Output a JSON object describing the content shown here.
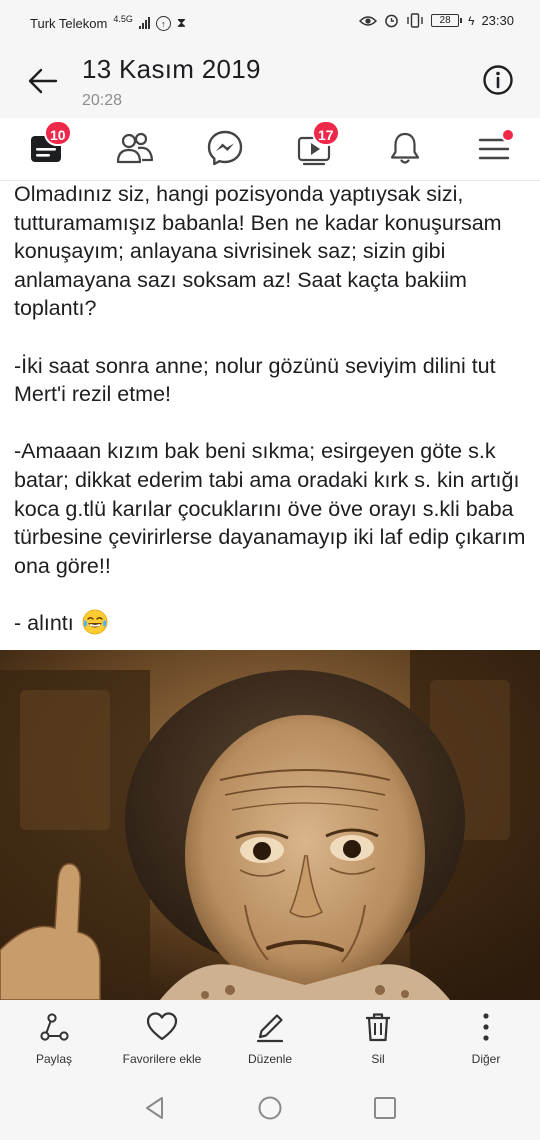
{
  "status_bar": {
    "carrier": "Turk Telekom",
    "network": "4.5G",
    "battery_level": "28",
    "time": "23:30",
    "icons": [
      "signal-icon",
      "data-saver-icon",
      "hourglass-icon",
      "eye-comfort-icon",
      "alarm-icon",
      "vibrate-icon",
      "battery-icon",
      "charging-icon"
    ]
  },
  "header": {
    "title": "13 Kasım 2019",
    "time": "20:28",
    "icons": [
      "back-arrow-icon",
      "info-icon"
    ]
  },
  "nav": {
    "items": [
      {
        "name": "home",
        "icon": "feed-icon",
        "badge": "10"
      },
      {
        "name": "friends",
        "icon": "friends-icon",
        "badge": ""
      },
      {
        "name": "messenger",
        "icon": "messenger-icon",
        "badge": ""
      },
      {
        "name": "watch",
        "icon": "video-icon",
        "badge": "17"
      },
      {
        "name": "notifications",
        "icon": "bell-icon",
        "badge": ""
      },
      {
        "name": "menu",
        "icon": "hamburger-icon",
        "badge": ""
      }
    ],
    "badge_color": "#f02849"
  },
  "post": {
    "paragraphs": [
      "Olmadınız siz, hangi pozisyonda yaptıysak sizi, tutturamamışız babanla! Ben ne kadar konuşursam konuşayım; anlayana sivrisinek saz; sizin gibi anlamayana sazı soksam az! Saat kaçta bakiim toplantı?",
      "-İki saat sonra anne; nolur gözünü seviyim dilini tut Mert'i rezil etme!",
      "-Amaaan kızım bak beni sıkma; esirgeyen göte s.k batar; dikkat ederim tabi ama oradaki kırk s. kin artığı koca g.tlü karılar çocuklarını öve öve orayı s.kli baba türbesine çevirirlerse dayanamayıp iki laf edip çıkarım ona göre!!",
      "- alıntı"
    ],
    "emoji": "tears-of-joy-emoji"
  },
  "actions": {
    "share": "Paylaş",
    "favorite": "Favorilere ekle",
    "edit": "Düzenle",
    "delete": "Sil",
    "more": "Diğer"
  },
  "colors": {
    "bar_background": "#f6f6f6",
    "text": "#1c1e21",
    "badge": "#f02849"
  }
}
